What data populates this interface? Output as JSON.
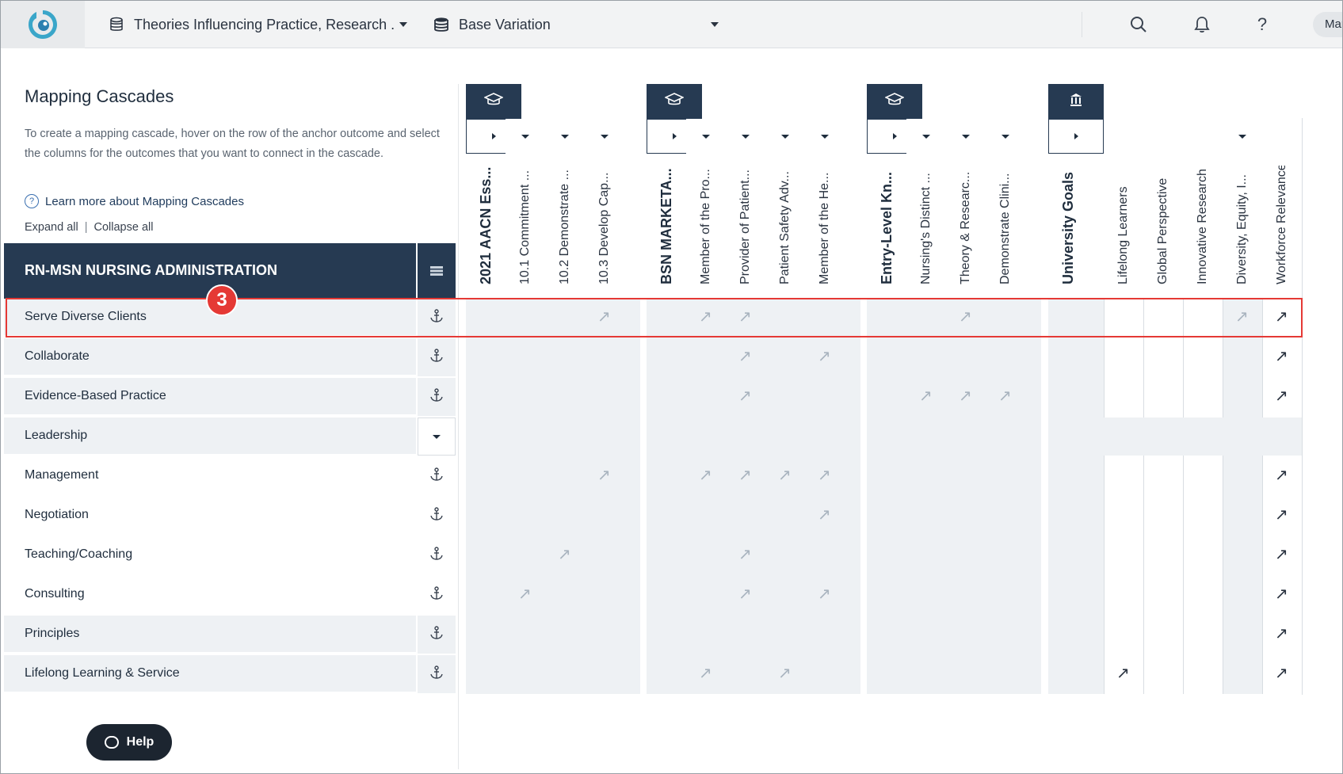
{
  "header": {
    "project_title": "Theories Influencing Practice, Research .",
    "variation_title": "Base Variation",
    "user_label": "Mar",
    "icons": [
      "logo-icon",
      "database-icon",
      "layers-icon",
      "search-icon",
      "bell-icon",
      "help-icon"
    ]
  },
  "panel": {
    "title": "Mapping Cascades",
    "description": "To create a mapping cascade, hover on the row of the anchor outcome and select the columns for the outcomes that you want to connect in the cascade.",
    "learn_more": "Learn more about Mapping Cascades",
    "expand_all": "Expand all",
    "separator": "|",
    "collapse_all": "Collapse all"
  },
  "program": {
    "name": "RN-MSN NURSING ADMINISTRATION"
  },
  "rows": [
    {
      "label": "Serve Diverse Clients",
      "bold": false
    },
    {
      "label": "Collaborate",
      "bold": false
    },
    {
      "label": "Evidence-Based Practice",
      "bold": false
    },
    {
      "label": "Leadership",
      "bold": false
    },
    {
      "label": "Management",
      "bold": true
    },
    {
      "label": "Negotiation",
      "bold": true
    },
    {
      "label": "Teaching/Coaching",
      "bold": true
    },
    {
      "label": "Consulting",
      "bold": true
    },
    {
      "label": "Principles",
      "bold": false
    },
    {
      "label": "Lifelong Learning & Service",
      "bold": false
    }
  ],
  "columns": [
    {
      "label": "2021 AACN Ess...",
      "bold": true
    },
    {
      "label": "10.1 Commitment ...",
      "bold": false
    },
    {
      "label": "10.2 Demonstrate ...",
      "bold": false
    },
    {
      "label": "10.3 Develop Cap...",
      "bold": false
    },
    {
      "label": "BSN MARKETA...",
      "bold": true
    },
    {
      "label": "Member of the Pro...",
      "bold": false
    },
    {
      "label": "Provider of Patient...",
      "bold": false
    },
    {
      "label": "Patient Safety Adv...",
      "bold": false
    },
    {
      "label": "Member of the He...",
      "bold": false
    },
    {
      "label": "Entry-Level Kn...",
      "bold": true
    },
    {
      "label": "Nursing's Distinct ...",
      "bold": false
    },
    {
      "label": "Theory & Researc...",
      "bold": false
    },
    {
      "label": "Demonstrate Clini...",
      "bold": false
    },
    {
      "label": "University Goals",
      "bold": true
    },
    {
      "label": "Lifelong Learners",
      "bold": false
    },
    {
      "label": "Global Perspective",
      "bold": false
    },
    {
      "label": "Innovative Research",
      "bold": false
    },
    {
      "label": "Diversity, Equity, I...",
      "bold": false
    },
    {
      "label": "Workforce Relevance",
      "bold": false
    }
  ],
  "mappings": [
    [
      0,
      3
    ],
    [
      0,
      5
    ],
    [
      0,
      6
    ],
    [
      0,
      11
    ],
    [
      0,
      17
    ],
    [
      0,
      18
    ],
    [
      1,
      6
    ],
    [
      1,
      8
    ],
    [
      1,
      18
    ],
    [
      2,
      6
    ],
    [
      2,
      10
    ],
    [
      2,
      11
    ],
    [
      2,
      12
    ],
    [
      2,
      18
    ],
    [
      4,
      3
    ],
    [
      4,
      5
    ],
    [
      4,
      6
    ],
    [
      4,
      7
    ],
    [
      4,
      8
    ],
    [
      4,
      18
    ],
    [
      5,
      8
    ],
    [
      5,
      18
    ],
    [
      6,
      2
    ],
    [
      6,
      6
    ],
    [
      6,
      18
    ],
    [
      7,
      1
    ],
    [
      7,
      6
    ],
    [
      7,
      8
    ],
    [
      7,
      18
    ],
    [
      8,
      18
    ],
    [
      9,
      5
    ],
    [
      9,
      7
    ],
    [
      9,
      14
    ],
    [
      9,
      18
    ]
  ],
  "mapping_glyph": "↗",
  "step_badge": "3",
  "help_label": "Help",
  "colors": {
    "navy": "#263a52",
    "highlight": "#e53935",
    "shade": "#eef1f4"
  }
}
